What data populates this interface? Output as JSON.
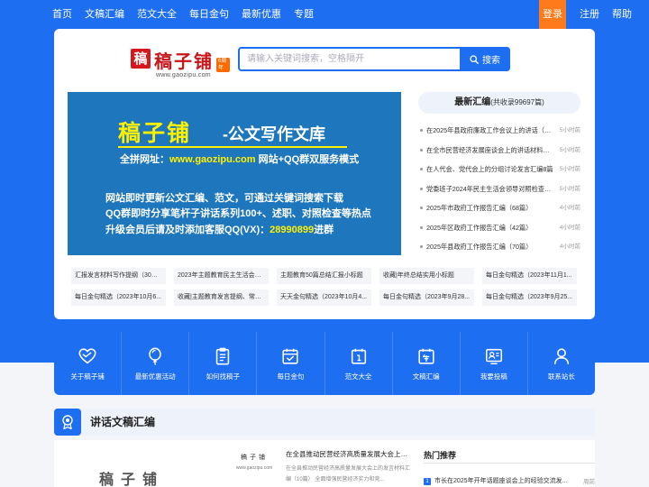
{
  "nav": {
    "items": [
      "首页",
      "文稿汇编",
      "范文大全",
      "每日金句",
      "最新优惠",
      "专题"
    ],
    "login": "登录",
    "register": "注册",
    "help": "帮助"
  },
  "logo": {
    "badge": "稿",
    "text": "稿子铺",
    "tag": "6周年",
    "url": "www.gaozipu.com"
  },
  "search": {
    "placeholder": "请输入关键词搜索，空格隔开",
    "button": "搜索"
  },
  "banner": {
    "title": "稿子铺",
    "subtitle": "-公文写作文库",
    "url_prefix": "全拼网址：",
    "url": "www.gaozipu.com",
    "url_suffix": " 网站+QQ群双服务模式",
    "line1": "网站即时更新公文汇编、范文，可通过关键词搜索下载",
    "line2": "QQ群即时分享笔杆子讲话系列100+、述职、对照检查等热点",
    "line3_prefix": "升级会员后请及时添加客服QQ(VX)：",
    "line3_qq": "28990899",
    "line3_suffix": "进群"
  },
  "latest": {
    "title": "最新汇编",
    "count": "(共收录99697篇)",
    "items": [
      {
        "title": "在2025年县政府廉政工作会议上的讲话（2篇）",
        "time": "5小时前"
      },
      {
        "title": "在全市民营经济发展座谈会上的讲话材料汇编（3篇）",
        "time": "5小时前"
      },
      {
        "title": "在人代会、党代会上的分组讨论发言汇编8篇",
        "time": "5小时前"
      },
      {
        "title": "党委班子2024年民主生活会领导对照检查材料汇编（4篇）",
        "time": "5小时前"
      },
      {
        "title": "2025年市政府工作报告汇编（68篇）",
        "time": "4小时前"
      },
      {
        "title": "2025年区政府工作报告汇编（42篇）",
        "time": "4小时前"
      },
      {
        "title": "2025年县政府工作报告汇编（70篇）",
        "time": "4小时前"
      }
    ]
  },
  "tags": [
    "汇报发言材料写作提纲（30组）",
    "2023年主题教育民主生活会、...",
    "主题教育50篇总结汇报小标题",
    "收藏|年终总结实用小标题",
    "每日金句精选（2023年11月1...",
    "每日金句精选（2023年10月6...",
    "收藏|主题教育发言提纲、常用...",
    "天天金句精选（2023年10月4...",
    "每日金句精选（2023年9月28...",
    "每日金句精选（2023年9月25..."
  ],
  "quick": [
    {
      "icon": "heart-icon",
      "label": "关于稿子铺"
    },
    {
      "icon": "balloon-icon",
      "label": "最新优惠活动"
    },
    {
      "icon": "clipboard-icon",
      "label": "如何找稿子"
    },
    {
      "icon": "calendar-check-icon",
      "label": "每日金句"
    },
    {
      "icon": "calendar-icon",
      "label": "范文大全"
    },
    {
      "icon": "year-calendar-icon",
      "label": "文稿汇编"
    },
    {
      "icon": "submit-icon",
      "label": "我要投稿"
    },
    {
      "icon": "user-icon",
      "label": "联系站长"
    }
  ],
  "section": {
    "title": "讲话文稿汇编"
  },
  "article": {
    "thumb_text": "稿子铺",
    "thumb_small_a": "稿子铺",
    "thumb_small_b": "www.gaozipu.com",
    "title": "在全县推动民营经济高质量发展大会上的...",
    "desc": "在全县推动民营经济高质量发展大会上的发言材料汇编（10篇） 全面增强民营经济实力和竞..."
  },
  "hot": {
    "title": "热门推荐",
    "item": {
      "num": "1",
      "title": "市长在2025年开年话题座谈会上的经验交流发...",
      "time": "周前"
    }
  },
  "colors": {
    "primary": "#1d6ef0",
    "login": "#ff7a1a",
    "banner": "#1e77bd",
    "logo_red": "#c8151a"
  }
}
